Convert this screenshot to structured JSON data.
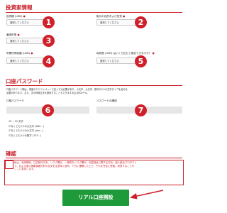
{
  "investor_section": {
    "title": "投資家情報",
    "fields": [
      {
        "label": "投資額 (USD)",
        "req": "●",
        "value": "選択してください",
        "marker": "1"
      },
      {
        "label": "取引の目的および性質",
        "req": "●",
        "value": "選択してください",
        "marker": "2"
      },
      {
        "label": "雇用形態",
        "req": "●",
        "value": "選択してください",
        "marker": "3"
      },
      {
        "label": "年間所得総額 (USD)",
        "req": "●",
        "value": "選択してください",
        "marker": "4"
      },
      {
        "label": "純資産 (USD) はいくら位だと推定できますか？",
        "req": "●",
        "value": "選択してください",
        "marker": "5"
      }
    ]
  },
  "password_section": {
    "title": "口座パスワード",
    "desc_1": "口座パスワード欄は、英語のアルファベットで記入する必要があり、小文字、大文字、数字の3つの文字タイプを含める",
    "desc_2": "必要があります。また、次の特殊文字を使用することもできます#[]()@$&*!%,.",
    "password_label": "口座パスワード",
    "password_marker": "6",
    "confirm_label": "パスワードの確認",
    "confirm_marker": "7",
    "requirements": [
      "10 ‒ 15 文字",
      "少なくとも1つの大文字 (ABC...)",
      "少なくとも1つの小文字 (abc...)",
      "少なくとも1つの数字 (123...)"
    ]
  },
  "confirm_section": {
    "title": "確認",
    "text_1": "私は、利用規約、注文執行方針、リスク開示、一般的なリスク開示、利益相反に関する方針、個人統合プロダクト",
    "text_2": "ト、および個人情報保護方針の全文を注意深く読み、十分に理解した上で、それを完全に受諾、同意することを",
    "text_3": "ここに宣言します。"
  },
  "submit_label": "リアル口座開設",
  "colors": {
    "accent": "#c8202a",
    "button": "#1f9a3a",
    "field_bg": "#e6e6e6"
  }
}
